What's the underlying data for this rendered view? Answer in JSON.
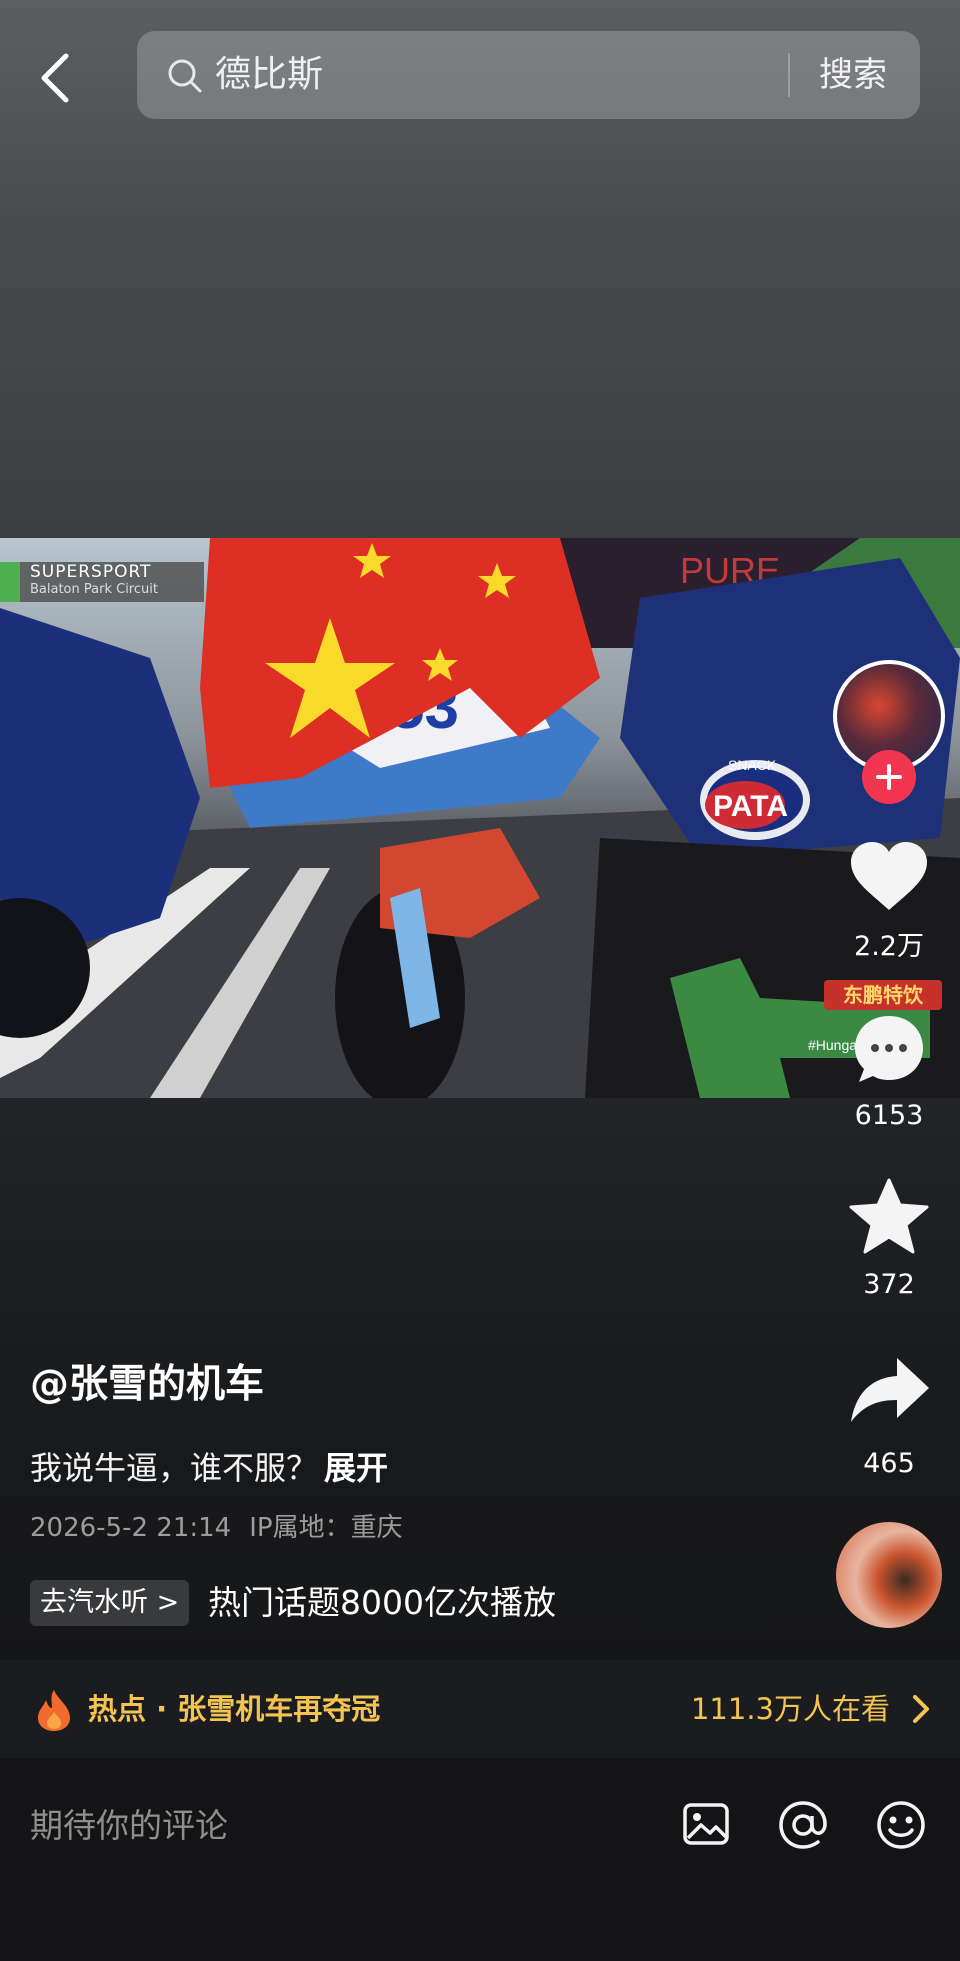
{
  "search": {
    "query": "德比斯",
    "button_label": "搜索"
  },
  "video": {
    "overlay_title": "SUPERSPORT",
    "overlay_subtitle": "Balaton Park Circuit",
    "bike_number": "53",
    "sponsor_text": "PATA",
    "sponsor_snack": "SNACK",
    "hashtag": "#Hunga",
    "billboard": "PURE"
  },
  "rail": {
    "likes": "2.2万",
    "brand_badge": "东鹏特饮",
    "comments": "6153",
    "favorites": "372",
    "shares": "465"
  },
  "post": {
    "author": "@张雪的机车",
    "caption": "我说牛逼，谁不服？",
    "expand_label": "展开",
    "date": "2026-5-2 21:14",
    "ip_location": "IP属地：重庆",
    "tag_chip": "去汽水听 >",
    "topic_text": "热门话题8000亿次播放"
  },
  "hot": {
    "title": "热点 · 张雪机车再夺冠",
    "viewers": "111.3万人在看"
  },
  "comment": {
    "placeholder": "期待你的评论"
  },
  "colors": {
    "accent_red": "#f2354f",
    "hot_yellow": "#f3c451",
    "badge_red": "#c7312b"
  },
  "icons": [
    "back-icon",
    "search-icon",
    "plus-icon",
    "heart-icon",
    "comment-icon",
    "star-icon",
    "share-icon",
    "fire-icon",
    "chevron-right-icon",
    "image-icon",
    "at-icon",
    "emoji-icon"
  ]
}
